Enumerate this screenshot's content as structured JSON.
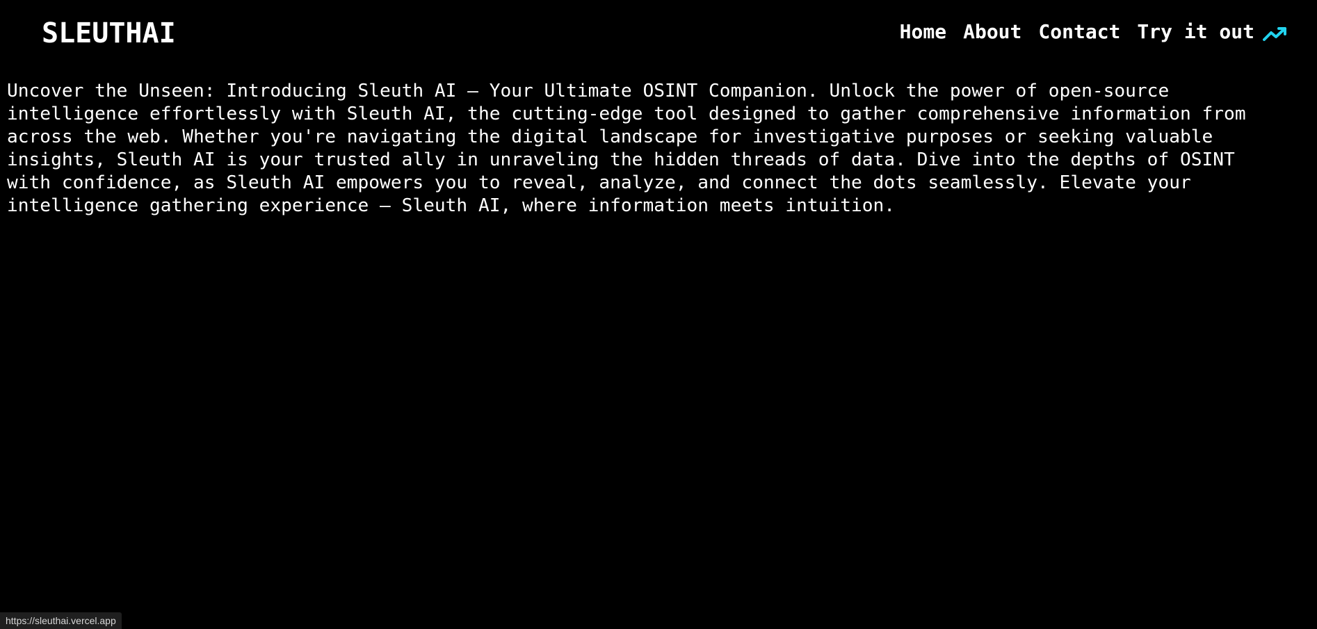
{
  "header": {
    "logo": "SLEUTHAI",
    "nav": {
      "home": "Home",
      "about": "About",
      "contact": "Contact",
      "try_it_out": "Try it out",
      "try_icon": "trending-up-icon"
    }
  },
  "main": {
    "intro_lines": [
      "Uncover the Unseen: Introducing Sleuth AI – Your Ultimate OSINT Companion. Unlock the power of open-source",
      "intelligence effortlessly with Sleuth AI, the cutting-edge tool designed to gather comprehensive information from",
      "across the web. Whether you're navigating the digital landscape for investigative purposes or seeking valuable",
      "insights, Sleuth AI is your trusted ally in unraveling the hidden threads of data. Dive into the depths of OSINT",
      "with confidence, as Sleuth AI empowers you to reveal, analyze, and connect the dots seamlessly. Elevate your",
      "intelligence gathering experience – Sleuth AI, where information meets intuition."
    ]
  },
  "status_bar": {
    "url": "https://sleuthai.vercel.app"
  },
  "colors": {
    "background": "#000000",
    "text": "#ffffff",
    "accent": "#22d3ee"
  }
}
